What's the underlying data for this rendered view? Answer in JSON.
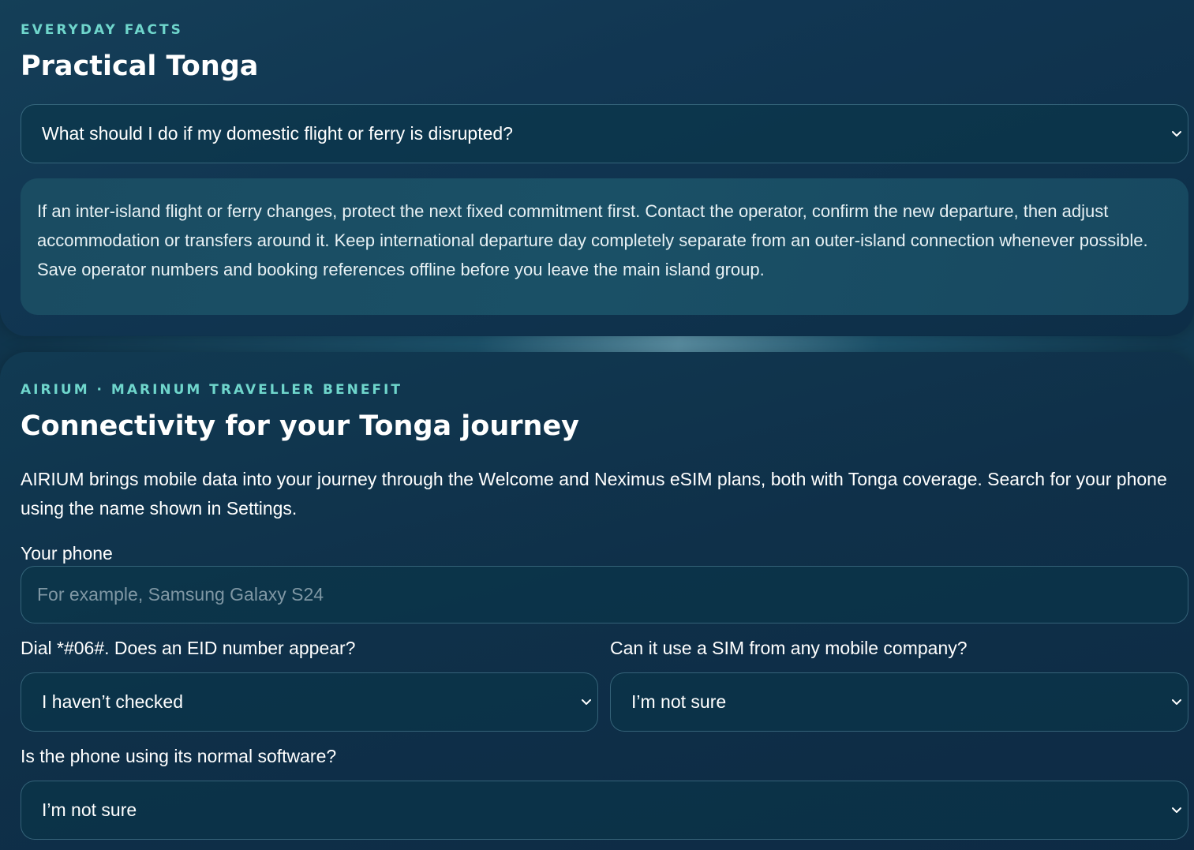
{
  "facts": {
    "eyebrow": "EVERYDAY FACTS",
    "title": "Practical Tonga",
    "question": "What should I do if my domestic flight or ferry is disrupted?",
    "answer": "If an inter-island flight or ferry changes, protect the next fixed commitment first. Contact the operator, confirm the new departure, then adjust accommodation or transfers around it. Keep international departure day completely separate from an outer-island connection whenever possible. Save operator numbers and booking references offline before you leave the main island group."
  },
  "connectivity": {
    "eyebrow": "AIRIUM · MARINUM TRAVELLER BENEFIT",
    "title": "Connectivity for your Tonga journey",
    "intro": "AIRIUM brings mobile data into your journey through the Welcome and Neximus eSIM plans, both with Tonga coverage. Search for your phone using the name shown in Settings.",
    "phone_label": "Your phone",
    "phone_placeholder": "For example, Samsung Galaxy S24",
    "phone_value": "",
    "eid_label": "Dial *#06#. Does an EID number appear?",
    "eid_value": "I haven’t checked",
    "sim_label": "Can it use a SIM from any mobile company?",
    "sim_value": "I’m not sure",
    "software_label": "Is the phone using its normal software?",
    "software_value": "I’m not sure"
  },
  "icons": {
    "dropdown": "chevron-down-icon"
  },
  "colors": {
    "accent": "#6fd6cc",
    "card_bg": "#113652",
    "answer_bg": "#1a4c62"
  }
}
